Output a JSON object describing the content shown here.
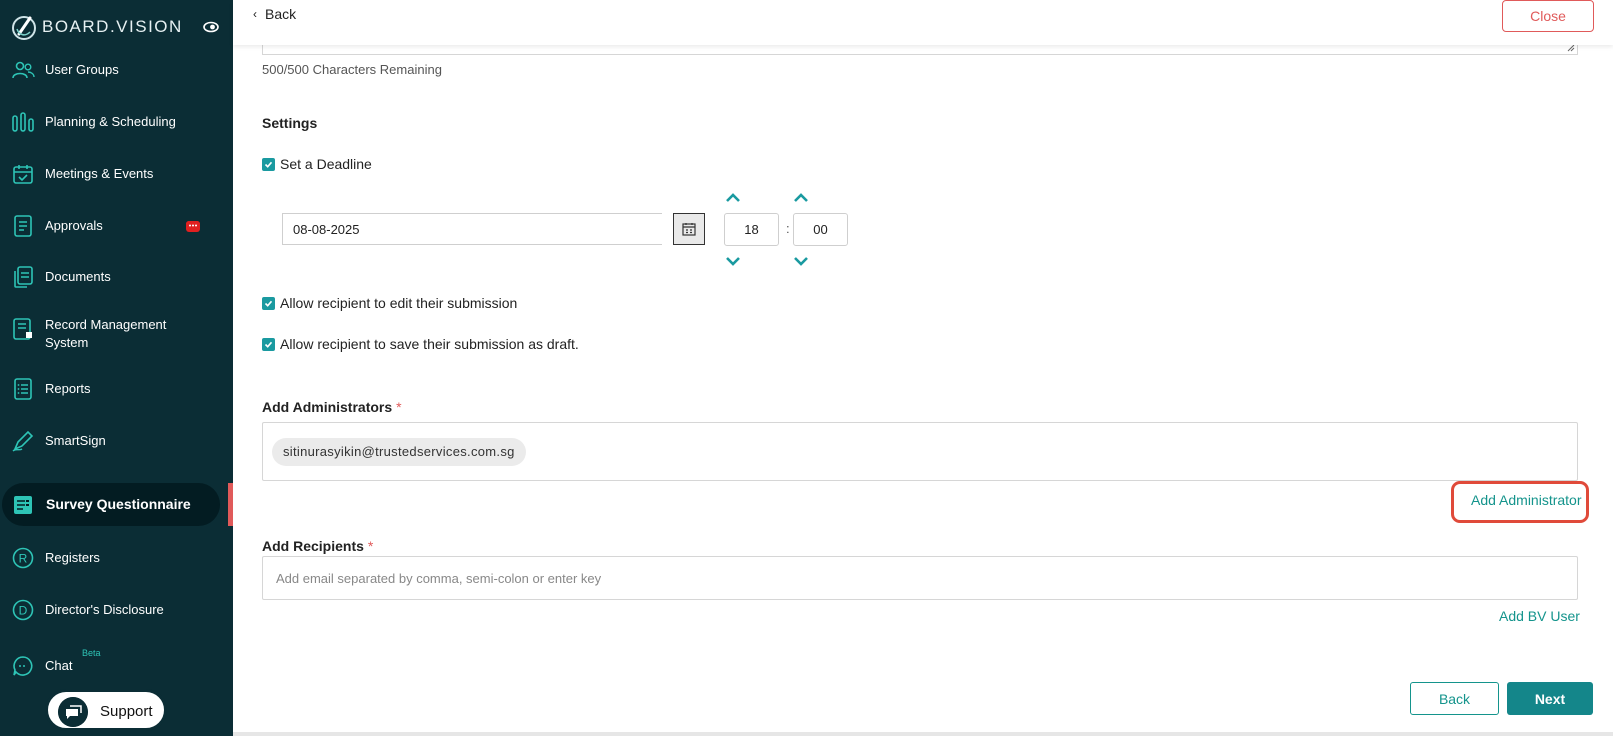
{
  "brand": {
    "name": "BOARD.VISION"
  },
  "sidebar": {
    "items": [
      {
        "label": "User Groups",
        "icon": "users-icon"
      },
      {
        "label": "Planning & Scheduling",
        "icon": "bars-icon"
      },
      {
        "label": "Meetings & Events",
        "icon": "calendar-check-icon"
      },
      {
        "label": "Approvals",
        "icon": "approval-doc-icon"
      },
      {
        "label": "Documents",
        "icon": "documents-icon"
      },
      {
        "label": "Record Management System",
        "icon": "record-icon"
      },
      {
        "label": "Reports",
        "icon": "list-icon"
      },
      {
        "label": "SmartSign",
        "icon": "pen-icon"
      },
      {
        "label": "Survey Questionnaire",
        "icon": "survey-icon",
        "active": true
      },
      {
        "label": "Registers",
        "icon": "registered-icon"
      },
      {
        "label": "Director's Disclosure",
        "icon": "disclosure-icon"
      },
      {
        "label": "Chat",
        "icon": "chat-icon",
        "tag": "Beta"
      }
    ],
    "support_label": "Support"
  },
  "header": {
    "back_label": "Back",
    "close_label": "Close"
  },
  "form": {
    "char_count": "500/500 Characters Remaining",
    "settings_title": "Settings",
    "deadline_label": "Set a Deadline",
    "deadline_checked": true,
    "date_value": "08-08-2025",
    "hour_value": "18",
    "minute_value": "00",
    "time_separator": ":",
    "allow_edit_label": "Allow recipient to edit their submission",
    "allow_draft_label": "Allow recipient to save their submission as draft.",
    "admins_title": "Add Administrators",
    "required_mark": "*",
    "admin_chip": "sitinurasyikin@trustedservices.com.sg",
    "add_admin_link": "Add Administrator",
    "recipients_title": "Add Recipients",
    "recipients_placeholder": "Add email separated by comma, semi-colon or enter key",
    "add_bv_user_link": "Add BV User"
  },
  "footer": {
    "back_label": "Back",
    "next_label": "Next"
  },
  "colors": {
    "sidebar": "#0b2d35",
    "accent": "#14948c",
    "danger": "#e05a5a",
    "highlight_ring": "#e04a3a"
  }
}
